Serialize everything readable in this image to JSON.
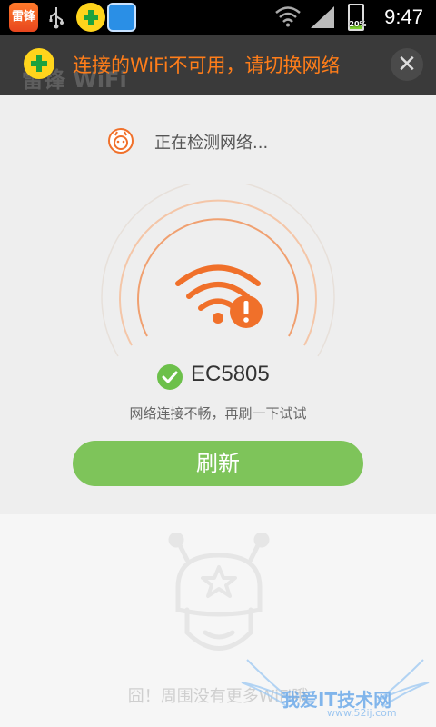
{
  "status_bar": {
    "app_badge_text": "雷锋",
    "battery_percent": "20%",
    "battery_level": 0.2,
    "time": "9:47",
    "icons": [
      "leifeng-app-icon",
      "usb-icon",
      "security-app-icon",
      "store-app-icon",
      "wifi-signal-icon",
      "cell-signal-icon",
      "battery-icon"
    ]
  },
  "header": {
    "ghost_title": "雷锋 WiFi",
    "toast_message": "连接的WiFi不可用，请切换网络",
    "close_label": "✕"
  },
  "scan": {
    "status_text": "正在检测网络...",
    "ssid": "EC5805",
    "hint": "网络连接不畅，再刷一下试试",
    "refresh_label": "刷新"
  },
  "empty": {
    "message": "囧！周围没有更多WiFi哦"
  },
  "watermark": {
    "text": "我爱IT技术网",
    "url": "www.52ij.com"
  },
  "colors": {
    "accent_orange": "#f0702a",
    "toast_orange": "#ff7d19",
    "refresh_green": "#7ec45a",
    "check_green": "#6cc04a",
    "header_bg": "#3a3a3a"
  }
}
